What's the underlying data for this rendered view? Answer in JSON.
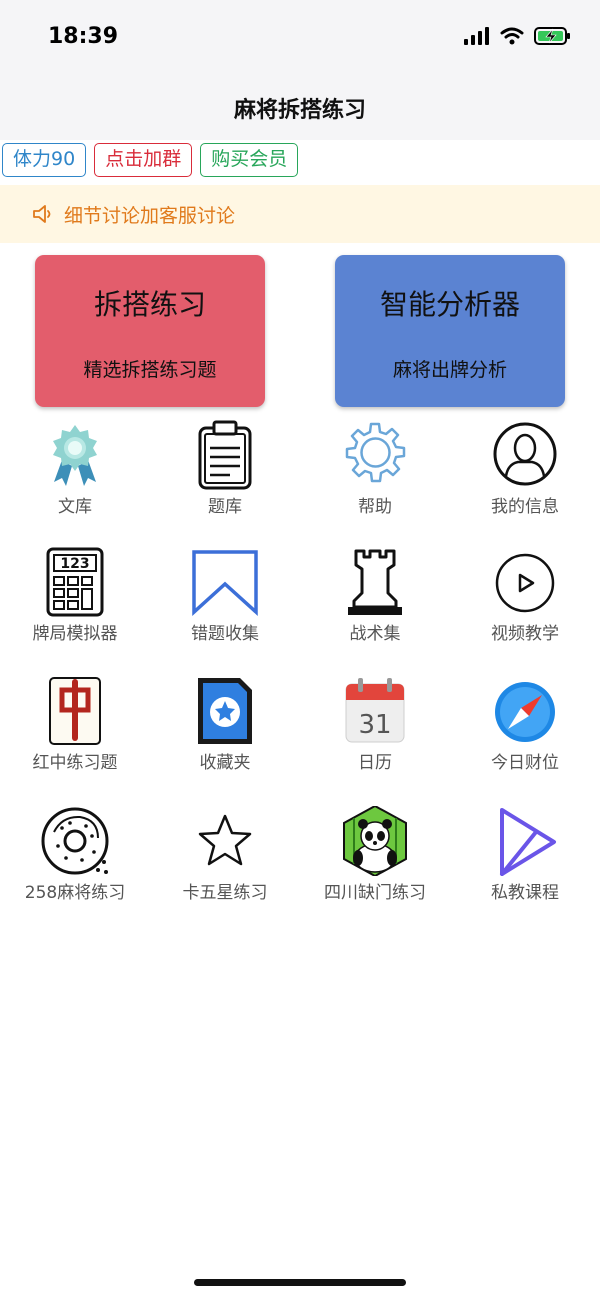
{
  "status": {
    "time": "18:39"
  },
  "nav": {
    "title": "麻将拆搭练习"
  },
  "chips": [
    {
      "label": "体力90"
    },
    {
      "label": "点击加群"
    },
    {
      "label": "购买会员"
    }
  ],
  "notice": {
    "text": "细节讨论加客服讨论"
  },
  "cards": [
    {
      "title": "拆搭练习",
      "subtitle": "精选拆搭练习题",
      "color": "#e35d6c"
    },
    {
      "title": "智能分析器",
      "subtitle": "麻将出牌分析",
      "color": "#5b83d2"
    }
  ],
  "grid": [
    {
      "label": "文库",
      "icon": "award-ribbon-icon"
    },
    {
      "label": "题库",
      "icon": "clipboard-icon"
    },
    {
      "label": "帮助",
      "icon": "gear-icon"
    },
    {
      "label": "我的信息",
      "icon": "user-avatar-icon"
    },
    {
      "label": "牌局模拟器",
      "icon": "calculator-icon"
    },
    {
      "label": "错题收集",
      "icon": "bookmark-icon"
    },
    {
      "label": "战术集",
      "icon": "chess-rook-icon"
    },
    {
      "label": "视频教学",
      "icon": "play-circle-icon"
    },
    {
      "label": "红中练习题",
      "icon": "mahjong-red-dragon-icon"
    },
    {
      "label": "收藏夹",
      "icon": "star-file-icon"
    },
    {
      "label": "日历",
      "icon": "calendar-icon",
      "icon_text": "31"
    },
    {
      "label": "今日财位",
      "icon": "compass-icon"
    },
    {
      "label": "258麻将练习",
      "icon": "donut-icon"
    },
    {
      "label": "卡五星练习",
      "icon": "star-outline-icon"
    },
    {
      "label": "四川缺门练习",
      "icon": "panda-icon"
    },
    {
      "label": "私教课程",
      "icon": "send-arrow-icon"
    }
  ]
}
